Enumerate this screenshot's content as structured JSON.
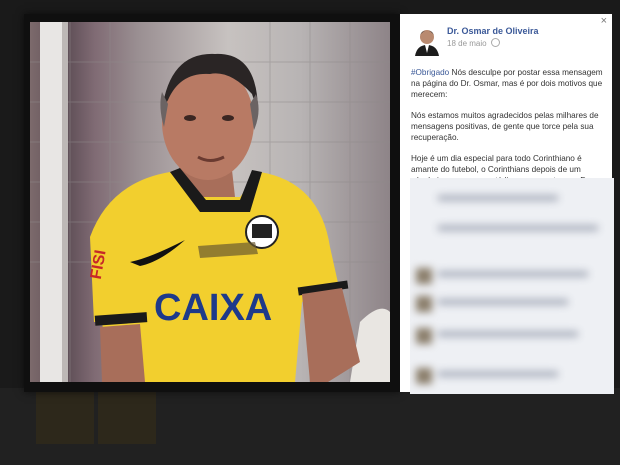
{
  "post": {
    "author": "Dr. Osmar de Oliveira",
    "date": "18 de maio",
    "hashtag": "#Obrigado",
    "p1_rest": " Nós desculpe por postar essa mensagem na página do Dr. Osmar, mas é por dois motivos que merecem:",
    "p2": "Nós estamos muitos agradecidos pelas milhares de mensagens positivas, de gente que torce pela sua recuperação.",
    "p3": "Hoje é um dia especial para todo Corinthiano é amante do futebol, o Corinthians depois de um século inaugura seu estádio, e sem certeza, o Dr. Osmar está feliz"
  },
  "close_symbol": "×",
  "photo": {
    "shirt_text": "CAIXA",
    "sleeve_text": "FISI",
    "shirt_color": "#f2cf2e",
    "collar_color": "#1a1a1a"
  },
  "colors": {
    "link": "#3b5998",
    "panel_bg": "#ffffff"
  }
}
